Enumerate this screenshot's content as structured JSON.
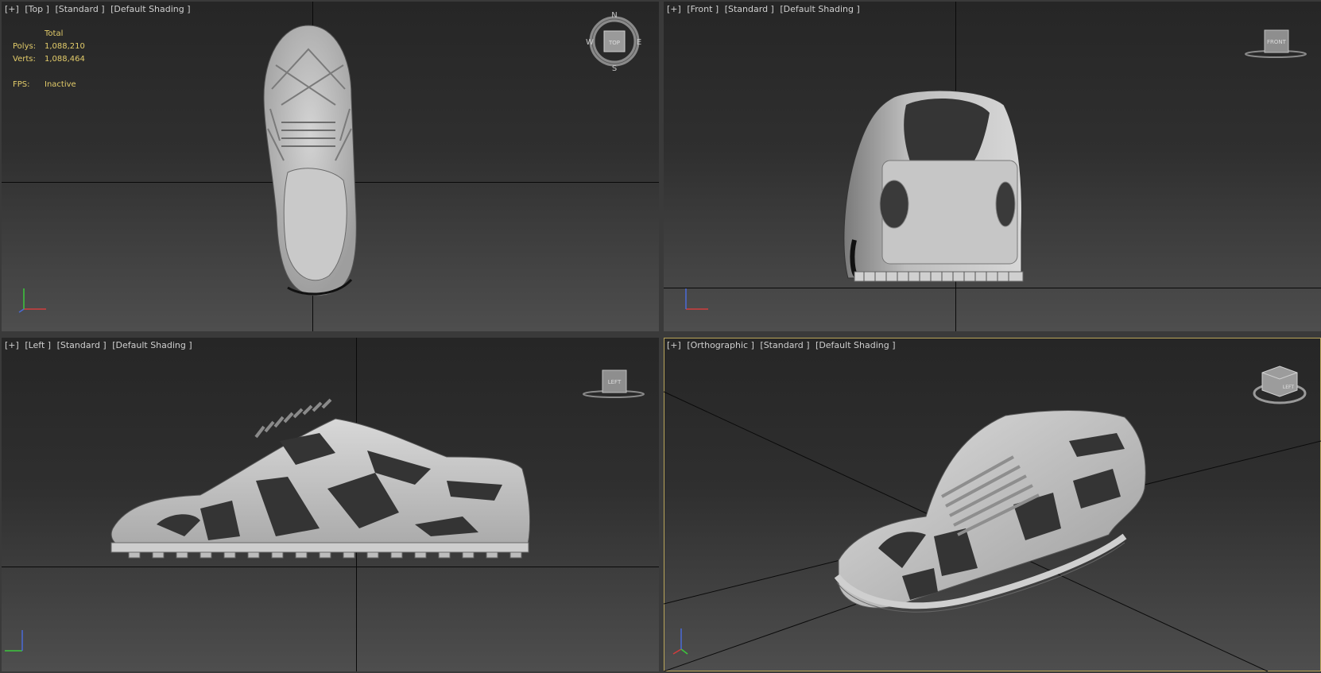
{
  "viewports": {
    "top": {
      "labels": [
        "[+]",
        "[Top ]",
        "[Standard ]",
        "[Default Shading ]"
      ],
      "stats": {
        "header": "Total",
        "polys_label": "Polys:",
        "polys_value": "1,088,210",
        "verts_label": "Verts:",
        "verts_value": "1,088,464",
        "fps_label": "FPS:",
        "fps_value": "Inactive"
      },
      "compass": {
        "n": "N",
        "s": "S",
        "e": "E",
        "w": "W",
        "cube": "TOP"
      }
    },
    "front": {
      "labels": [
        "[+]",
        "[Front ]",
        "[Standard ]",
        "[Default Shading ]"
      ],
      "cube": "FRONT"
    },
    "left": {
      "labels": [
        "[+]",
        "[Left ]",
        "[Standard ]",
        "[Default Shading ]"
      ],
      "cube": "LEFT"
    },
    "ortho": {
      "labels": [
        "[+]",
        "[Orthographic ]",
        "[Standard ]",
        "[Default Shading ]"
      ],
      "cube": "LEFT"
    }
  },
  "colors": {
    "active_border": "#b9a55a",
    "stats_text": "#e3cc6a",
    "axis_x": "#d23c3c",
    "axis_y": "#3cc83c",
    "axis_z": "#4a6ad8"
  }
}
